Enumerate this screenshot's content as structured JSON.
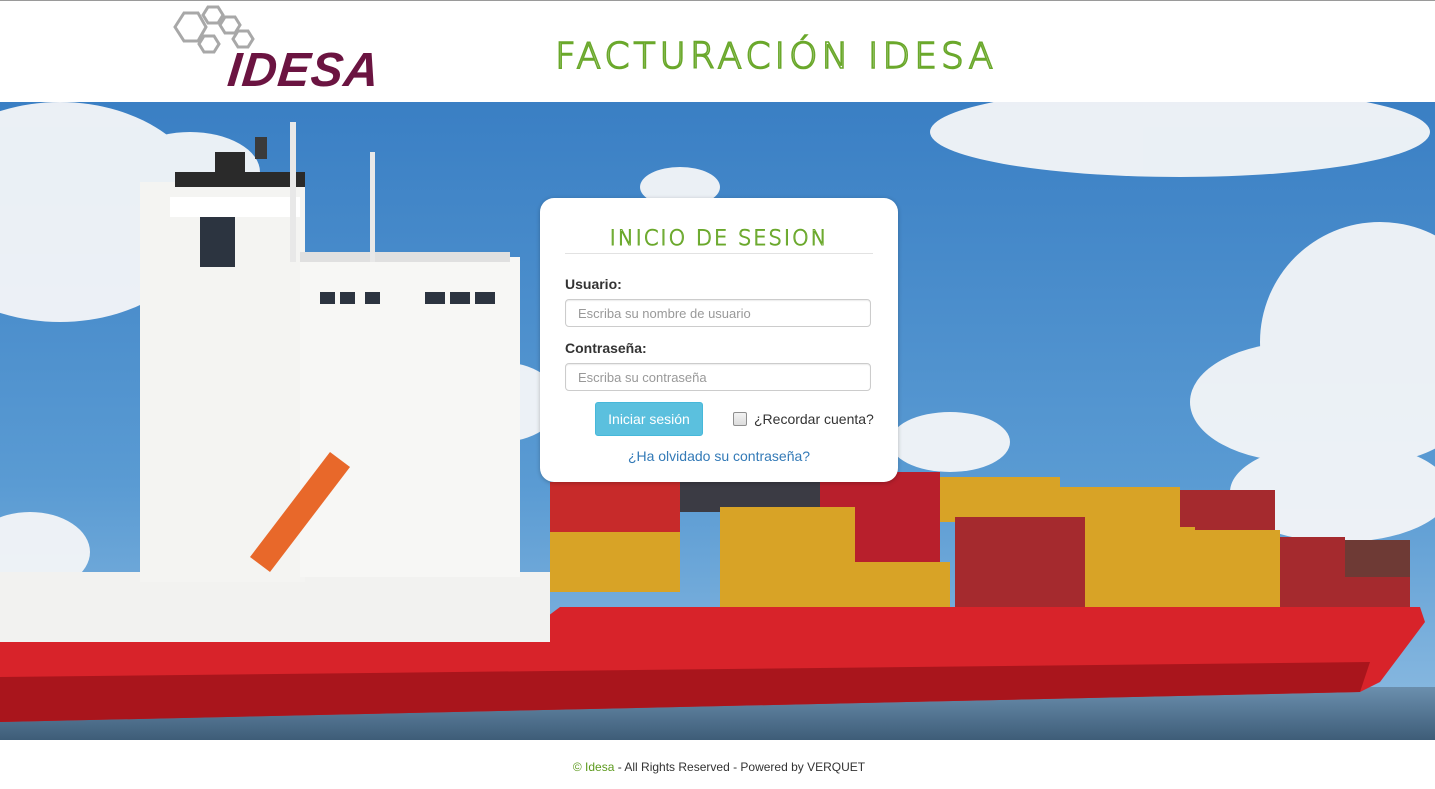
{
  "colors": {
    "brand_green": "#6aa82b",
    "brand_purple": "#6b1441",
    "button_info": "#5bc0de",
    "link": "#337ab7"
  },
  "header": {
    "logo_text": "IDESA",
    "logo_icon": "hexagon-cluster-icon",
    "site_title": "FACTURACIÓN IDESA"
  },
  "hero": {
    "image": "container-ship-photo"
  },
  "login": {
    "title": "INICIO DE SESION",
    "username_label": "Usuario:",
    "username_placeholder": "Escriba su nombre de usuario",
    "username_value": "",
    "password_label": "Contraseña:",
    "password_placeholder": "Escriba su contraseña",
    "password_value": "",
    "submit_label": "Iniciar sesión",
    "remember_label": "¿Recordar cuenta?",
    "remember_checked": false,
    "forgot_link": "¿Ha olvidado su contraseña?"
  },
  "footer": {
    "copyright": "© Idesa",
    "rights": " - All Rights Reserved - Powered by VERQUET"
  }
}
